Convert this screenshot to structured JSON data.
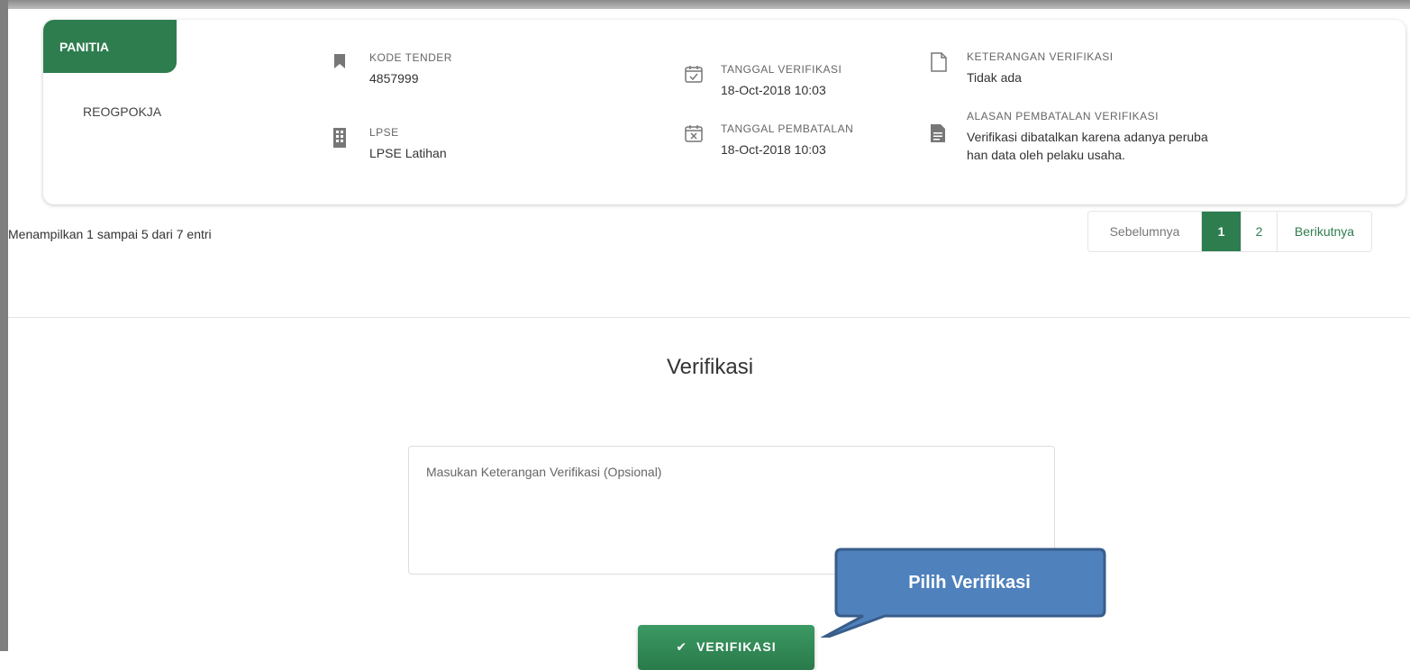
{
  "panel": {
    "tab_label": "PANITIA",
    "name": "REOGPOKJA"
  },
  "fields": {
    "kode_tender": {
      "label": "KODE TENDER",
      "value": "4857999",
      "icon": "bookmark-icon"
    },
    "lpse": {
      "label": "LPSE",
      "value": "LPSE Latihan",
      "icon": "building-icon"
    },
    "tanggal_verifikasi": {
      "label": "TANGGAL VERIFIKASI",
      "value": "18-Oct-2018 10:03",
      "icon": "calendar-check-icon"
    },
    "tanggal_pembatalan": {
      "label": "TANGGAL PEMBATALAN",
      "value": "18-Oct-2018 10:03",
      "icon": "calendar-x-icon"
    },
    "keterangan": {
      "label": "KETERANGAN VERIFIKASI",
      "value": "Tidak ada",
      "icon": "document-outline-icon"
    },
    "alasan": {
      "label": "ALASAN PEMBATALAN VERIFIKASI",
      "line1": "Verifikasi dibatalkan karena adanya peruba",
      "line2": "han data oleh pelaku usaha.",
      "icon": "document-filled-icon"
    }
  },
  "table_info": "Menampilkan 1 sampai 5 dari 7 entri",
  "pagination": {
    "prev": "Sebelumnya",
    "pages": [
      "1",
      "2"
    ],
    "current": "1",
    "next": "Berikutnya"
  },
  "verification": {
    "title": "Verifikasi",
    "placeholder": "Masukan Keterangan Verifikasi (Opsional)",
    "button": "VERIFIKASI",
    "callout": "Pilih Verifikasi"
  },
  "colors": {
    "accent": "#2e7d4f",
    "callout_fill": "#4f81bd",
    "callout_border": "#385d8a"
  }
}
